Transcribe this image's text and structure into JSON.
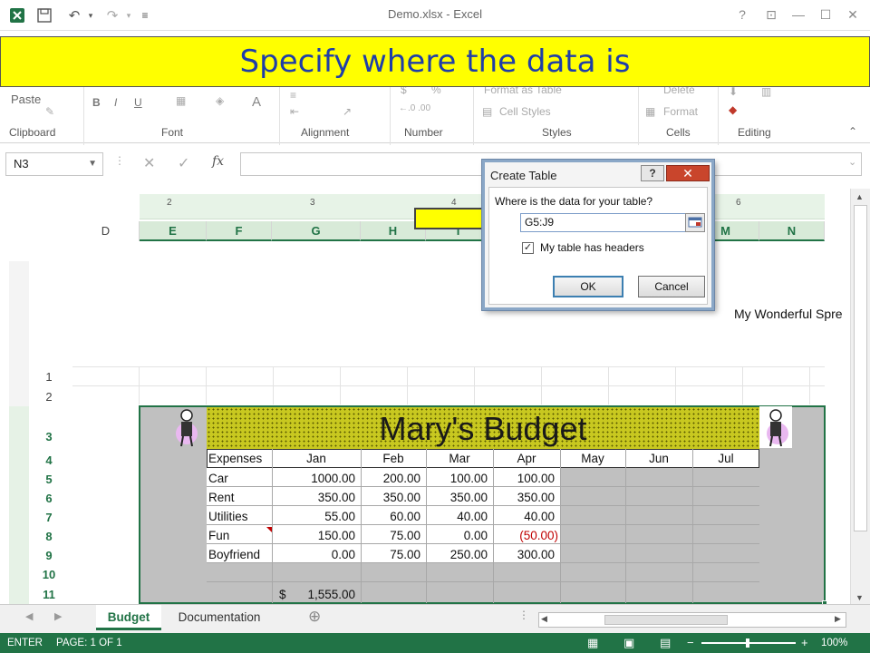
{
  "window": {
    "title": "Demo.xlsx - Excel",
    "help": "?",
    "restore": "⊡",
    "minimize": "—",
    "maximize": "☐",
    "close": "✕"
  },
  "quick_access": {
    "undo": "↶",
    "redo": "↷",
    "customize": "≡"
  },
  "banner": {
    "text": "Specify where the data is"
  },
  "ribbon": {
    "paste_label": "Paste",
    "groups": [
      "Clipboard",
      "Font",
      "Alignment",
      "Number",
      "Styles",
      "Cells",
      "Editing"
    ],
    "format_as_table": "Format as Table",
    "cell_styles": "Cell Styles",
    "delete": "Delete",
    "format": "Format",
    "bold": "B",
    "italic": "I",
    "underline": "U",
    "font_color": "A",
    "percent": "%",
    "currency": "$"
  },
  "formula_bar": {
    "name_box": "N3",
    "fx": "fx",
    "value": ""
  },
  "ruler": {
    "marks": [
      "2",
      "3",
      "4",
      "6"
    ]
  },
  "columns": [
    "D",
    "E",
    "F",
    "G",
    "H",
    "I",
    "M",
    "N"
  ],
  "rows": [
    "1",
    "2",
    "3",
    "4",
    "5",
    "6",
    "7",
    "8",
    "9",
    "10",
    "11"
  ],
  "sheet": {
    "side_title": "My Wonderful Spre",
    "budget_title": "Mary's Budget",
    "headers": [
      "Expenses",
      "Jan",
      "Feb",
      "Mar",
      "Apr",
      "May",
      "Jun",
      "Jul"
    ],
    "rows": [
      {
        "label": "Car",
        "values": [
          "1000.00",
          "200.00",
          "100.00",
          "100.00"
        ]
      },
      {
        "label": "Rent",
        "values": [
          "350.00",
          "350.00",
          "350.00",
          "350.00"
        ]
      },
      {
        "label": "Utilities",
        "values": [
          "55.00",
          "60.00",
          "40.00",
          "40.00"
        ]
      },
      {
        "label": "Fun",
        "values": [
          "150.00",
          "75.00",
          "0.00",
          "(50.00)"
        ]
      },
      {
        "label": "Boyfriend",
        "values": [
          "0.00",
          "75.00",
          "250.00",
          "300.00"
        ]
      }
    ],
    "total_currency": "$",
    "total_value": "1,555.00"
  },
  "dialog": {
    "title": "Create Table",
    "help": "?",
    "close": "✕",
    "question": "Where is the data for your table?",
    "range_value": "G5:J9",
    "headers_checked": true,
    "headers_label": "My table has headers",
    "ok": "OK",
    "cancel": "Cancel"
  },
  "tabs": {
    "active": "Budget",
    "other": "Documentation",
    "add": "⊕"
  },
  "status": {
    "mode": "ENTER",
    "page": "PAGE: 1 OF 1",
    "zoom": "100%"
  },
  "colors": {
    "excel_green": "#217346",
    "banner_bg": "#ffff00",
    "banner_text": "#1f3ea8",
    "title_band": "#c8c820",
    "table_grey": "#c0c0c0",
    "negative": "#c00000"
  }
}
